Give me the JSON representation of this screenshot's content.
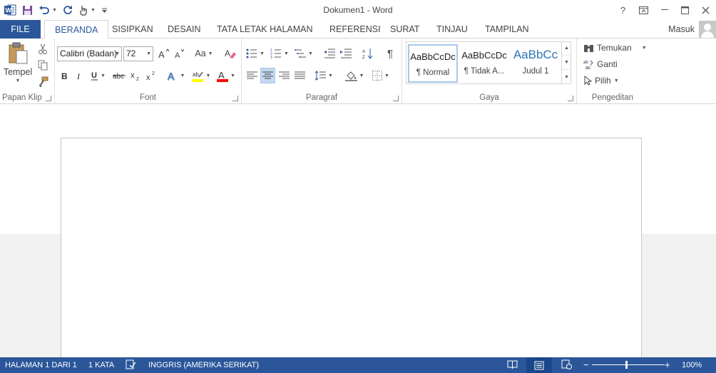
{
  "titlebar": {
    "title": "Dokumen1 - Word",
    "help": "?"
  },
  "tabs": [
    {
      "label": "FILE"
    },
    {
      "label": "BERANDA"
    },
    {
      "label": "SISIPKAN"
    },
    {
      "label": "DESAIN"
    },
    {
      "label": "TATA LETAK HALAMAN"
    },
    {
      "label": "REFERENSI"
    },
    {
      "label": "SURAT"
    },
    {
      "label": "TINJAU"
    },
    {
      "label": "TAMPILAN"
    }
  ],
  "account": {
    "label": "Masuk"
  },
  "clipboard": {
    "paste_label": "Tempel",
    "group_label": "Papan Klip"
  },
  "font": {
    "family": "Calibri (Badan)",
    "size": "72",
    "group_label": "Font",
    "case_label": "Aa"
  },
  "paragraph": {
    "group_label": "Paragraf"
  },
  "styles": {
    "group_label": "Gaya",
    "items": [
      {
        "preview": "AaBbCcDc",
        "name": "¶ Normal"
      },
      {
        "preview": "AaBbCcDc",
        "name": "¶ Tidak A..."
      },
      {
        "preview": "AaBbCc",
        "name": "Judul 1"
      }
    ]
  },
  "editing": {
    "find": "Temukan",
    "replace": "Ganti",
    "select": "Pilih",
    "group_label": "Pengeditan"
  },
  "status": {
    "page": "HALAMAN 1 DARI 1",
    "words": "1 KATA",
    "language": "INGGRIS (AMERIKA SERIKAT)",
    "zoom": "100%"
  },
  "colors": {
    "accent": "#2b579a",
    "highlight": "#ffff00",
    "font_color": "#ff0000",
    "heading_blue": "#2e74b5"
  }
}
